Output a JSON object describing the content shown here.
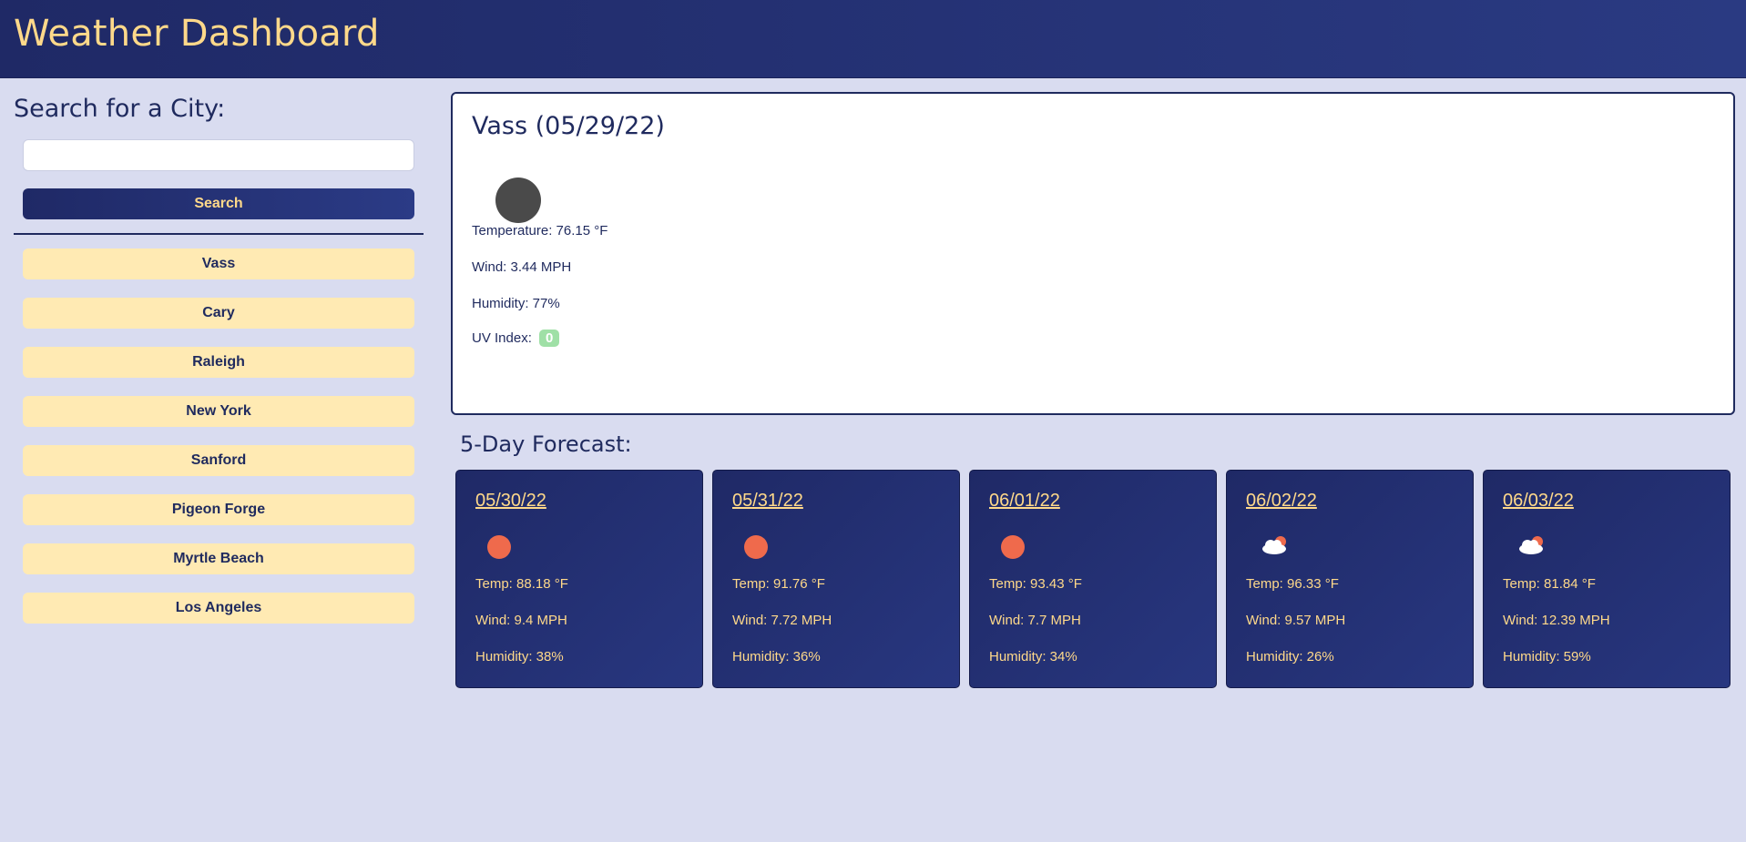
{
  "header": {
    "title": "Weather Dashboard"
  },
  "sidebar": {
    "heading": "Search for a City:",
    "search_value": "",
    "search_placeholder": "",
    "search_button": "Search",
    "history": [
      "Vass",
      "Cary",
      "Raleigh",
      "New York",
      "Sanford",
      "Pigeon Forge",
      "Myrtle Beach",
      "Los Angeles"
    ]
  },
  "current": {
    "title": "Vass (05/29/22)",
    "icon": "moon-icon",
    "temperature": "Temperature: 76.15 °F",
    "wind": "Wind: 3.44 MPH",
    "humidity": "Humidity: 77%",
    "uv_label": "UV Index:",
    "uv_value": "0",
    "uv_color": "#9fe0a6"
  },
  "forecast": {
    "title": "5-Day Forecast:",
    "days": [
      {
        "date": "05/30/22",
        "icon": "sun-icon",
        "temp": "Temp: 88.18 °F",
        "wind": "Wind: 9.4 MPH",
        "humidity": "Humidity: 38%"
      },
      {
        "date": "05/31/22",
        "icon": "sun-icon",
        "temp": "Temp: 91.76 °F",
        "wind": "Wind: 7.72 MPH",
        "humidity": "Humidity: 36%"
      },
      {
        "date": "06/01/22",
        "icon": "sun-icon",
        "temp": "Temp: 93.43 °F",
        "wind": "Wind: 7.7 MPH",
        "humidity": "Humidity: 34%"
      },
      {
        "date": "06/02/22",
        "icon": "partly-cloudy-icon",
        "temp": "Temp: 96.33 °F",
        "wind": "Wind: 9.57 MPH",
        "humidity": "Humidity: 26%"
      },
      {
        "date": "06/03/22",
        "icon": "partly-cloudy-icon",
        "temp": "Temp: 81.84 °F",
        "wind": "Wind: 12.39 MPH",
        "humidity": "Humidity: 59%"
      }
    ]
  },
  "colors": {
    "navy": "#1f2966",
    "accent_yellow": "#ffd98a",
    "history_button": "#ffeab3",
    "page_background": "#d9dcf0",
    "sun": "#ef6a4c"
  }
}
